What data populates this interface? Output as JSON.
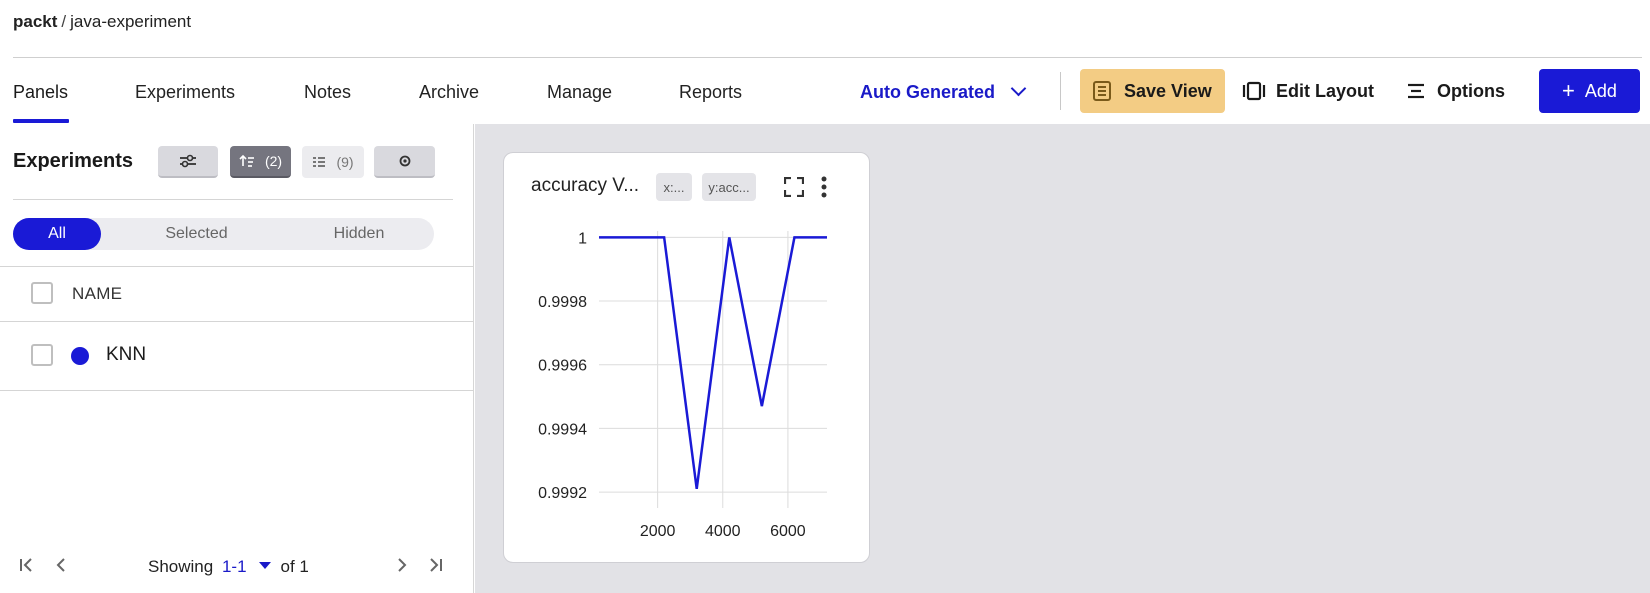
{
  "breadcrumb": {
    "workspace": "packt",
    "separator": "/",
    "project": "java-experiment"
  },
  "tabs": [
    {
      "label": "Panels",
      "active": true
    },
    {
      "label": "Experiments",
      "active": false
    },
    {
      "label": "Notes",
      "active": false
    },
    {
      "label": "Archive",
      "active": false
    },
    {
      "label": "Manage",
      "active": false
    },
    {
      "label": "Reports",
      "active": false
    }
  ],
  "toolbar": {
    "view_label": "Auto Generated",
    "save_view_label": "Save View",
    "edit_layout_label": "Edit Layout",
    "options_label": "Options",
    "add_label": "Add",
    "accent_color": "#1a1ad6",
    "save_color": "#f3cc84"
  },
  "sidebar": {
    "title": "Experiments",
    "sort_count": "(2)",
    "columns_count": "(9)",
    "filters": [
      "All",
      "Selected",
      "Hidden"
    ],
    "active_filter": "All",
    "column_header": "NAME",
    "rows": [
      {
        "name": "KNN",
        "color": "#1a1ad6"
      }
    ],
    "pager": {
      "showing": "Showing",
      "range": "1-1",
      "of": "of 1"
    }
  },
  "panel": {
    "title": "accuracy V...",
    "x_chip": "x:...",
    "y_chip": "y:acc..."
  },
  "chart_data": {
    "type": "line",
    "title": "accuracy V...",
    "xlabel": "",
    "ylabel": "",
    "x_ticks": [
      "2000",
      "4000",
      "6000"
    ],
    "y_ticks": [
      "1",
      "0.9998",
      "0.9996",
      "0.9994",
      "0.9992"
    ],
    "xlim": [
      200,
      7200
    ],
    "ylim": [
      0.99915,
      1.00002
    ],
    "grid": true,
    "series": [
      {
        "color": "#1a1ad6",
        "x": [
          200,
          2200,
          3200,
          4200,
          5200,
          6200,
          7200
        ],
        "y": [
          1.0,
          1.0,
          0.99921,
          1.0,
          0.99947,
          1.0,
          1.0
        ]
      }
    ]
  }
}
